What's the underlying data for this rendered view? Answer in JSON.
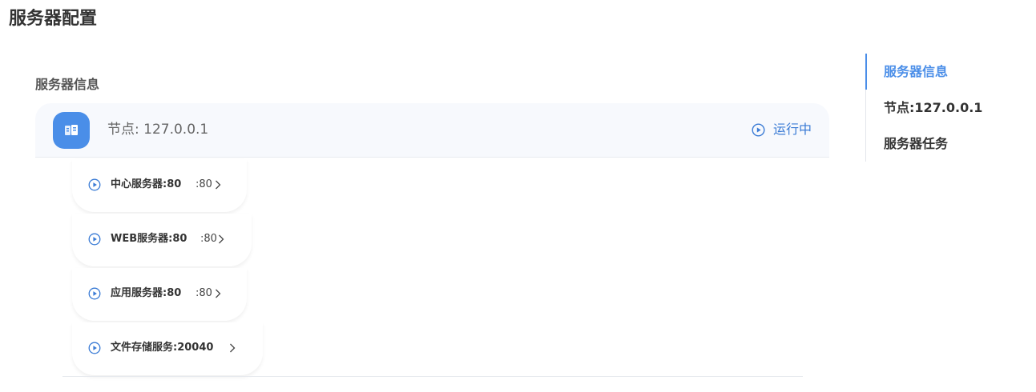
{
  "page": {
    "title": "服务器配置"
  },
  "section": {
    "title": "服务器信息"
  },
  "node": {
    "label": "节点: 127.0.0.1",
    "icon": "server-icon",
    "status": "运行中",
    "status_icon": "play-circle-icon"
  },
  "services": [
    {
      "name": "中心服务器:80",
      "port": ":80"
    },
    {
      "name": "WEB服务器:80",
      "port": ":80"
    },
    {
      "name": "应用服务器:80",
      "port": ":80"
    },
    {
      "name": "文件存储服务:20040",
      "port": ""
    }
  ],
  "anchor_nav": {
    "items": [
      {
        "label": "服务器信息",
        "active": true
      },
      {
        "label": "节点:127.0.0.1",
        "active": false
      },
      {
        "label": "服务器任务",
        "active": false
      }
    ]
  },
  "colors": {
    "accent": "#4a8ee8",
    "status": "#3a7bd5",
    "card_bg": "#f7f9fd"
  }
}
